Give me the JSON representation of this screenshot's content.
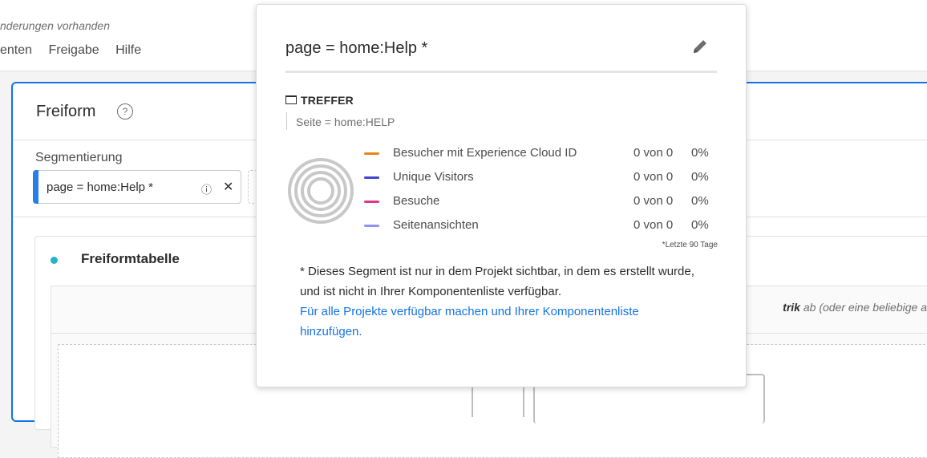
{
  "topbar": {
    "status_text": "nderungen vorhanden",
    "menu_items": [
      "enten",
      "Freigabe",
      "Hilfe"
    ]
  },
  "panel": {
    "title": "Freiform",
    "help_glyph": "?",
    "segment_label": "Segmentierung",
    "segment_chip": {
      "label": "page = home:Help *",
      "info_glyph": "ⓘ",
      "close_glyph": "✕"
    }
  },
  "inner": {
    "title": "Freiformtabelle",
    "drop_hint_bold": "trik",
    "drop_hint_rest": " ab (oder eine beliebige ander"
  },
  "popover": {
    "title": "page = home:Help *",
    "container_label": "TREFFER",
    "rule": "Seite = home:HELP",
    "metrics": [
      {
        "name": "Besucher mit Experience Cloud ID",
        "value": "0 von 0",
        "pct": "0%",
        "color": "#e68619"
      },
      {
        "name": "Unique Visitors",
        "value": "0 von 0",
        "pct": "0%",
        "color": "#4046ca"
      },
      {
        "name": "Besuche",
        "value": "0 von 0",
        "pct": "0%",
        "color": "#d83790"
      },
      {
        "name": "Seitenansichten",
        "value": "0 von 0",
        "pct": "0%",
        "color": "#9092f0"
      }
    ],
    "footnote": "*Letzte 90 Tage",
    "note": "* Dieses Segment ist nur in dem Projekt sichtbar, in dem es erstellt wurde, und ist nicht in Ihrer Komponentenliste verfügbar.",
    "link": "Für alle Projekte verfügbar machen und Ihrer Komponentenliste hinzufügen."
  },
  "colors": {
    "accent": "#1473e6",
    "panel_border": "#1473e6",
    "dot": "#26b5c6"
  }
}
